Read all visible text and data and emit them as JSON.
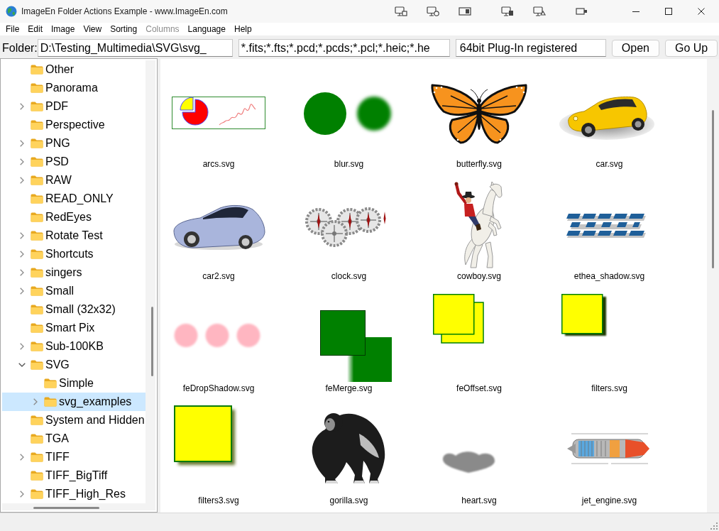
{
  "window": {
    "title": "ImageEn Folder Actions Example - www.ImageEn.com"
  },
  "menu": [
    {
      "label": "File",
      "disabled": false
    },
    {
      "label": "Edit",
      "disabled": false
    },
    {
      "label": "Image",
      "disabled": false
    },
    {
      "label": "View",
      "disabled": false
    },
    {
      "label": "Sorting",
      "disabled": false
    },
    {
      "label": "Columns",
      "disabled": true
    },
    {
      "label": "Language",
      "disabled": false
    },
    {
      "label": "Help",
      "disabled": false
    }
  ],
  "toolbar": {
    "folder_label": "Folder:",
    "folder_path": "D:\\Testing_Multimedia\\SVG\\svg_",
    "file_filter": "*.fits;*.fts;*.pcd;*.pcds;*.pcl;*.heic;*.he",
    "status": "64bit Plug-In registered",
    "buttons": [
      "Open",
      "Go Up"
    ]
  },
  "folder_tree": [
    {
      "label": "Other",
      "selected": false
    },
    {
      "label": "Panorama",
      "selected": false
    },
    {
      "label": "PDF",
      "expanded": false,
      "selected": false
    },
    {
      "label": "Perspective",
      "selected": false
    },
    {
      "label": "PNG",
      "expanded": false,
      "selected": false
    },
    {
      "label": "PSD",
      "expanded": false,
      "selected": false
    },
    {
      "label": "RAW",
      "expanded": false,
      "selected": false
    },
    {
      "label": "READ_ONLY",
      "selected": false
    },
    {
      "label": "RedEyes",
      "selected": false
    },
    {
      "label": "Rotate Test",
      "expanded": false,
      "selected": false
    },
    {
      "label": "Shortcuts",
      "expanded": false,
      "selected": false
    },
    {
      "label": "singers",
      "expanded": false,
      "selected": false
    },
    {
      "label": "Small",
      "expanded": false,
      "selected": false
    },
    {
      "label": "Small (32x32)",
      "selected": false
    },
    {
      "label": "Smart Pix",
      "selected": false
    },
    {
      "label": "Sub-100KB",
      "expanded": false,
      "selected": false
    },
    {
      "label": "SVG",
      "expanded": true,
      "selected": false,
      "children": [
        {
          "label": "Simple",
          "selected": false
        },
        {
          "label": "svg_examples",
          "expanded": false,
          "selected": true
        }
      ]
    },
    {
      "label": "System and Hidden",
      "selected": false
    },
    {
      "label": "TGA",
      "selected": false
    },
    {
      "label": "TIFF",
      "expanded": false,
      "selected": false
    },
    {
      "label": "TIFF_BigTiff",
      "selected": false
    },
    {
      "label": "TIFF_High_Res",
      "expanded": false,
      "selected": false
    }
  ],
  "thumbnails": [
    {
      "file_name": "arcs.svg",
      "kind": "arcs"
    },
    {
      "file_name": "blur.svg",
      "kind": "blur"
    },
    {
      "file_name": "butterfly.svg",
      "kind": "butterfly"
    },
    {
      "file_name": "car.svg",
      "kind": "car"
    },
    {
      "file_name": "car2.svg",
      "kind": "sportscar"
    },
    {
      "file_name": "clock.svg",
      "kind": "gears"
    },
    {
      "file_name": "cowboy.svg",
      "kind": "rider"
    },
    {
      "file_name": "ethea_shadow.svg",
      "kind": "logo"
    },
    {
      "file_name": "feDropShadow.svg",
      "kind": "dots"
    },
    {
      "file_name": "feMerge.svg",
      "kind": "merge"
    },
    {
      "file_name": "feOffset.svg",
      "kind": "offset"
    },
    {
      "file_name": "filters.svg",
      "kind": "shadow"
    },
    {
      "file_name": "filters3.svg",
      "kind": "bigshadow"
    },
    {
      "file_name": "gorilla.svg",
      "kind": "gorilla"
    },
    {
      "file_name": "heart.svg",
      "kind": "heart"
    },
    {
      "file_name": "jet_engine.svg",
      "kind": "engine"
    }
  ]
}
